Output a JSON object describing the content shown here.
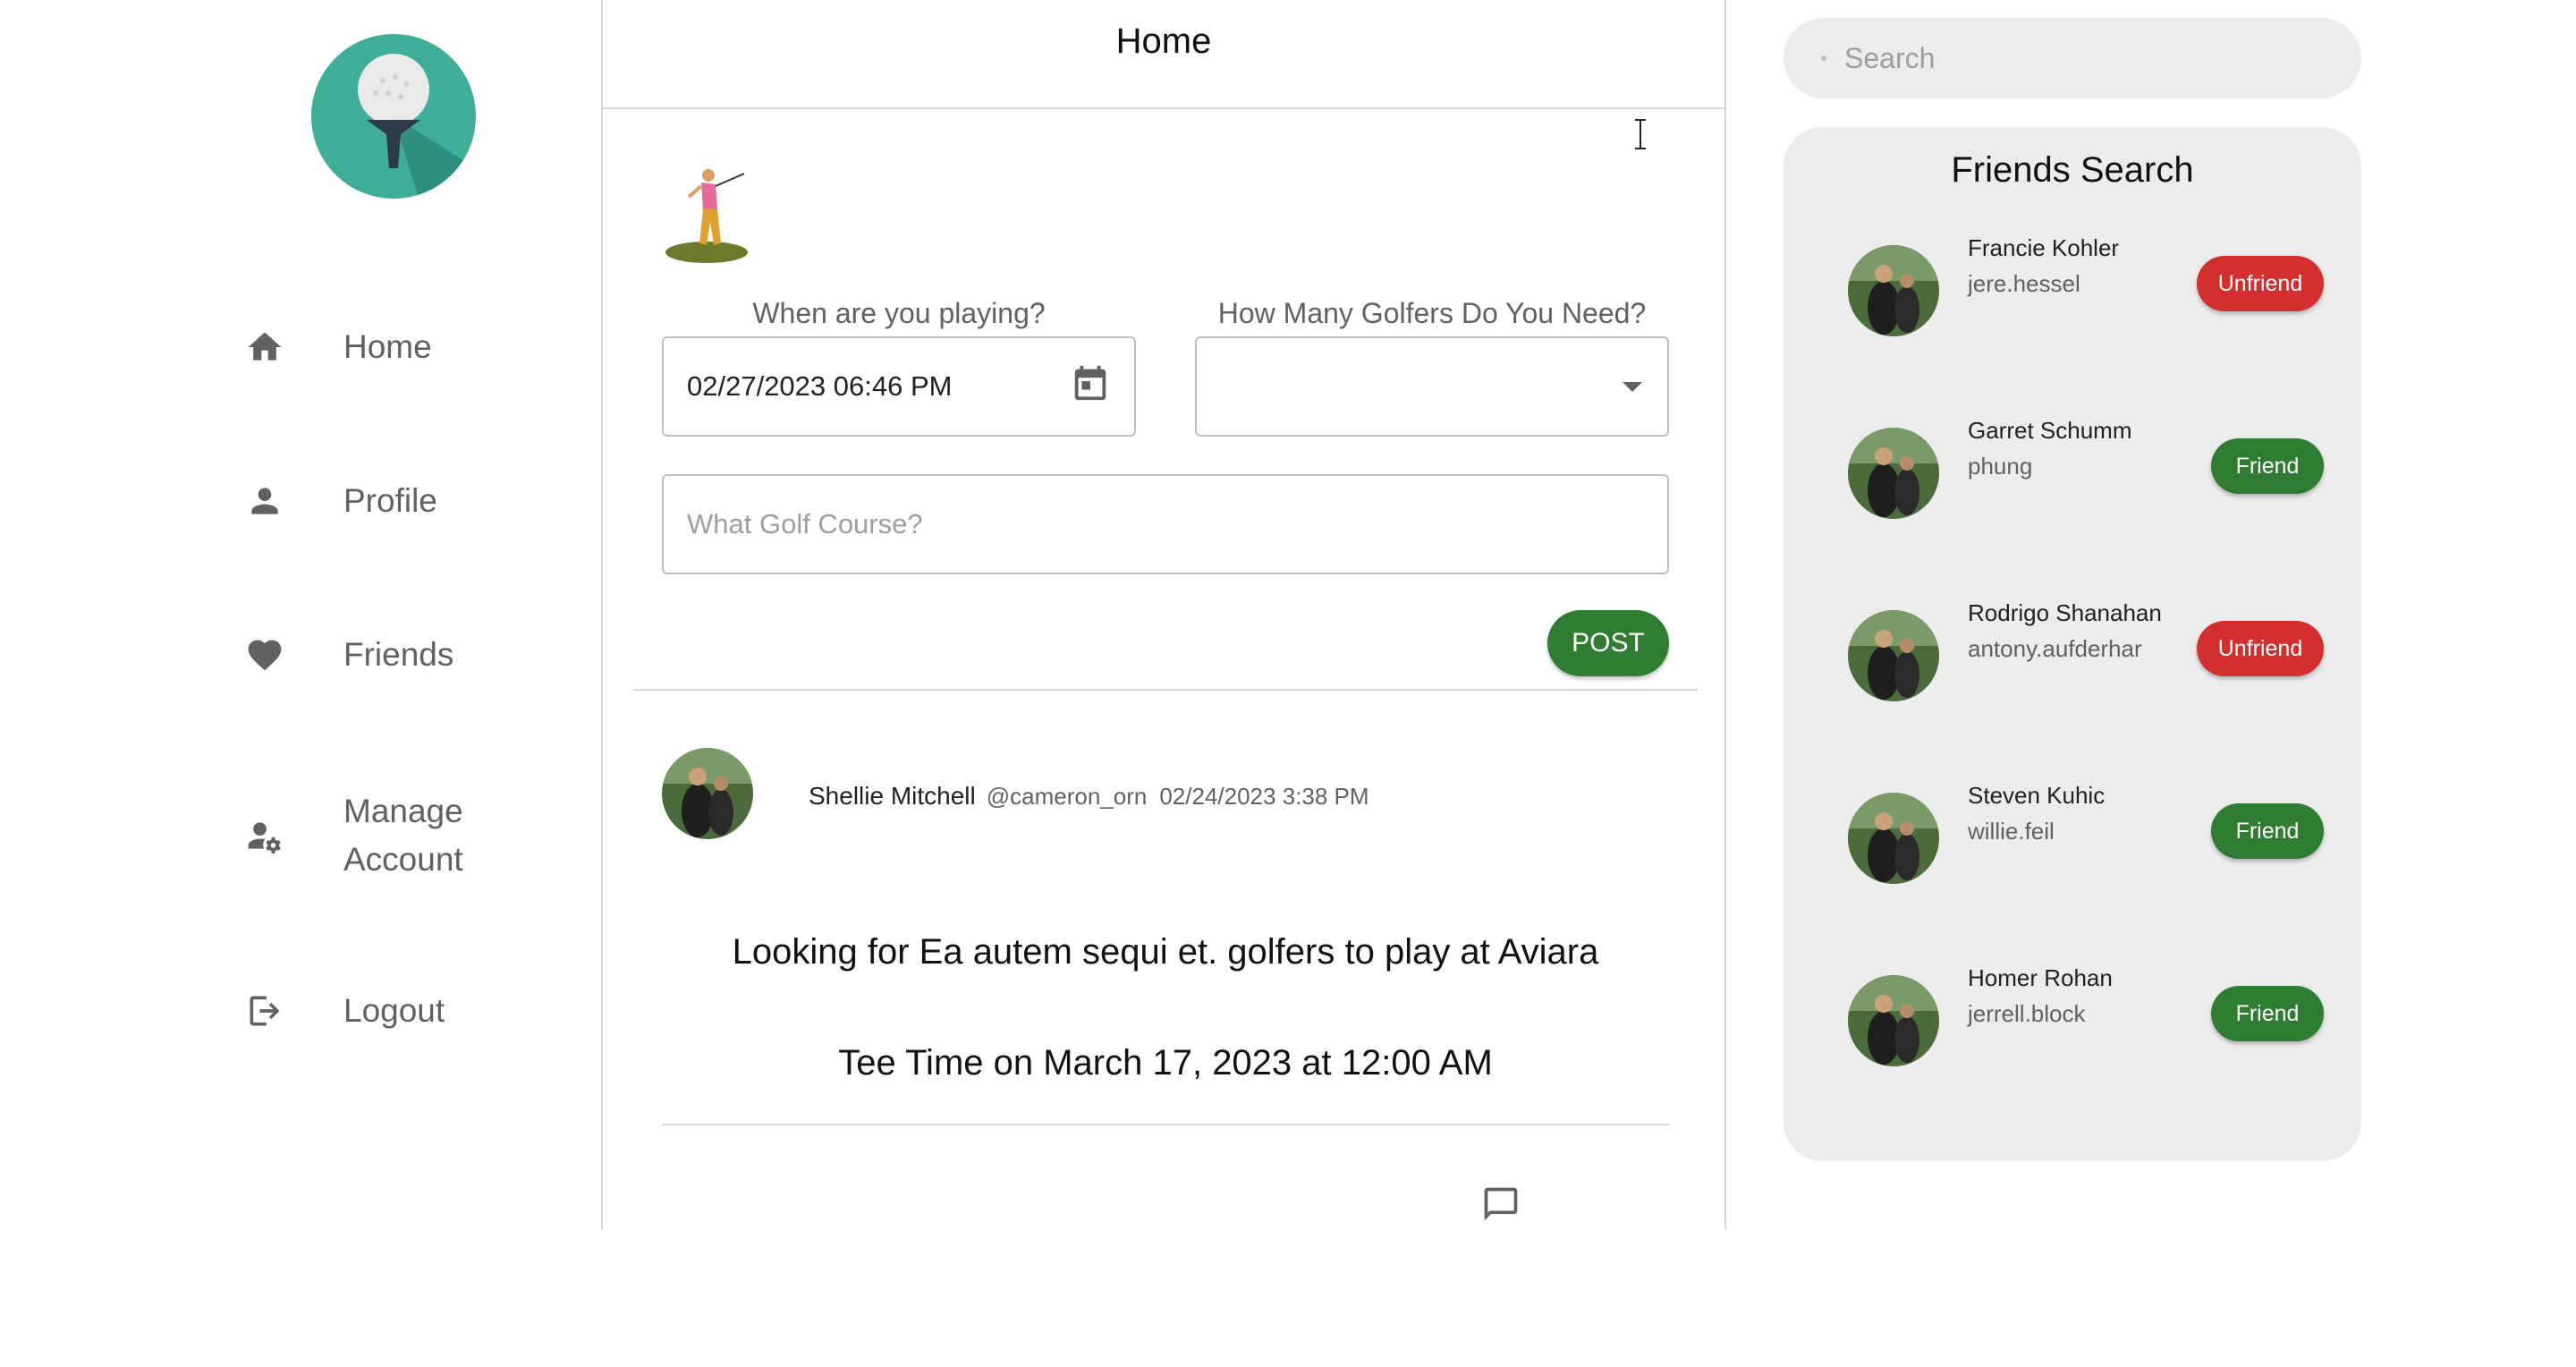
{
  "header": {
    "title": "Home"
  },
  "nav": {
    "items": [
      {
        "label": "Home",
        "icon": "home-icon"
      },
      {
        "label": "Profile",
        "icon": "person-icon"
      },
      {
        "label": "Friends",
        "icon": "heart-icon"
      },
      {
        "label": "Manage Account",
        "icon": "manage-account-icon"
      },
      {
        "label": "Logout",
        "icon": "logout-icon"
      }
    ]
  },
  "composer": {
    "when_label": "When are you playing?",
    "when_value": "02/27/2023 06:46 PM",
    "how_many_label": "How Many Golfers Do You Need?",
    "how_many_value": "",
    "course_placeholder": "What Golf Course?",
    "post_label": "POST"
  },
  "post": {
    "author": "Shellie Mitchell",
    "handle": "@cameron_orn",
    "timestamp": "02/24/2023 3:38 PM",
    "body": "Looking for Ea autem sequi et. golfers to play at Aviara",
    "tee_time": "Tee Time on March 17, 2023 at 12:00 AM"
  },
  "search": {
    "placeholder": "Search"
  },
  "friends": {
    "title": "Friends Search",
    "list": [
      {
        "name": "Francie Kohler",
        "handle": "jere.hessel",
        "action": "Unfriend"
      },
      {
        "name": "Garret Schumm",
        "handle": "phung",
        "action": "Friend"
      },
      {
        "name": "Rodrigo Shanahan",
        "handle": "antony.aufderhar",
        "action": "Unfriend"
      },
      {
        "name": "Steven Kuhic",
        "handle": "willie.feil",
        "action": "Friend"
      },
      {
        "name": "Homer Rohan",
        "handle": "jerrell.block",
        "action": "Friend"
      }
    ]
  },
  "colors": {
    "logo_bg": "#3fae99",
    "friend_button": "#2e7d32",
    "unfriend_button": "#d32f2f",
    "panel_bg": "#ececec"
  }
}
